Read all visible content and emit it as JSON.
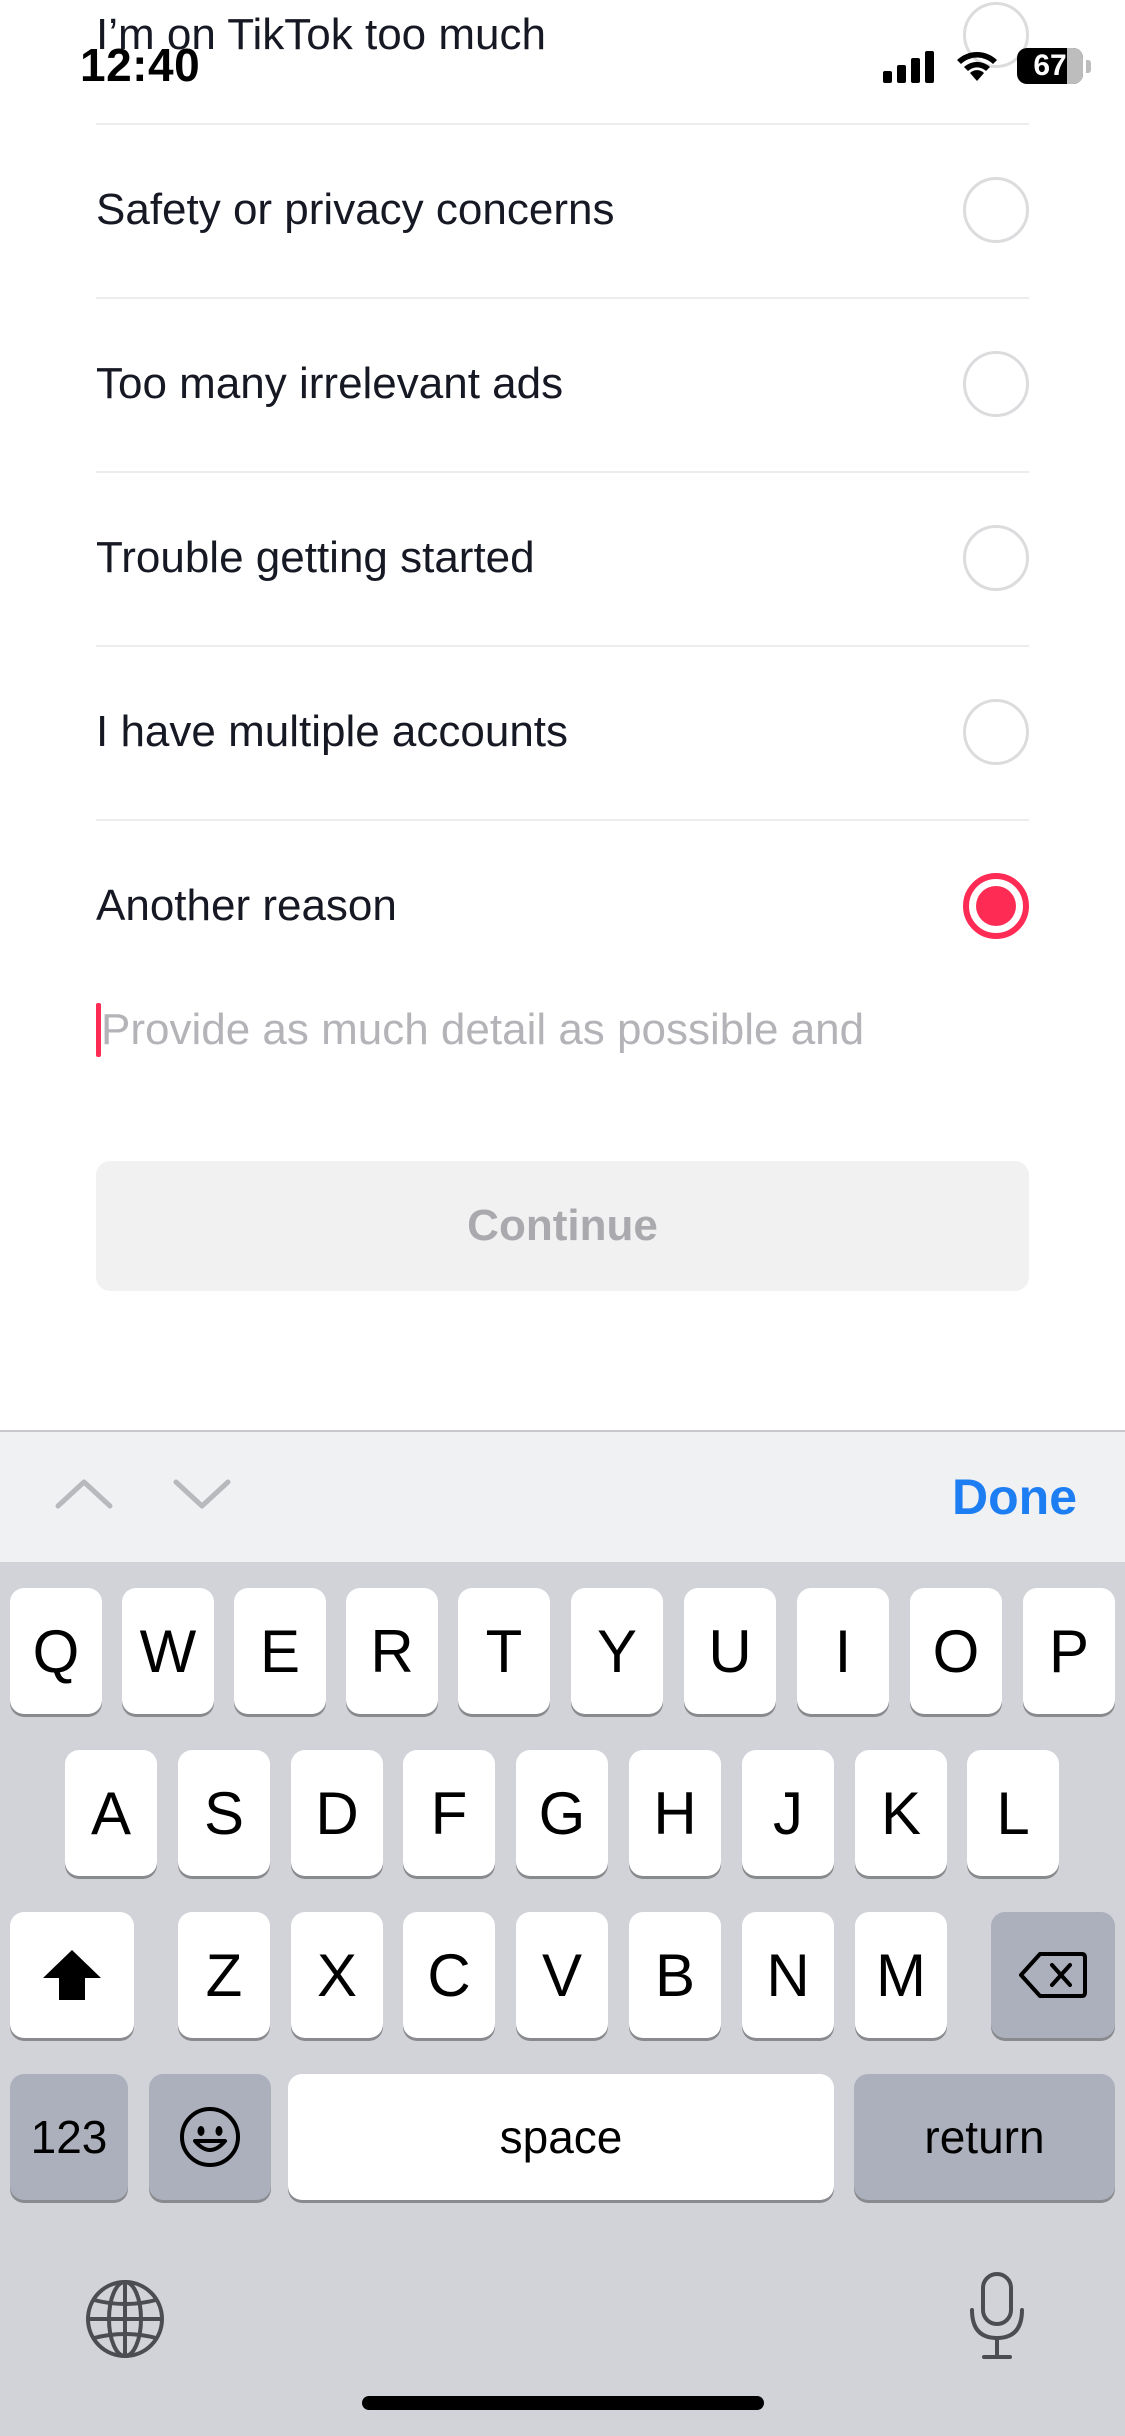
{
  "status_bar": {
    "time": "12:40",
    "battery": "67"
  },
  "options": [
    {
      "label": "I’m on TikTok too much",
      "selected": false
    },
    {
      "label": "Safety or privacy concerns",
      "selected": false
    },
    {
      "label": "Too many irrelevant ads",
      "selected": false
    },
    {
      "label": "Trouble getting started",
      "selected": false
    },
    {
      "label": "I have multiple accounts",
      "selected": false
    },
    {
      "label": "Another reason",
      "selected": true
    }
  ],
  "detail_input": {
    "placeholder": "Provide as much detail as possible and",
    "value": ""
  },
  "continue_button": {
    "label": "Continue",
    "enabled": false
  },
  "accessory_bar": {
    "done_label": "Done"
  },
  "keyboard": {
    "row1": [
      "Q",
      "W",
      "E",
      "R",
      "T",
      "Y",
      "U",
      "I",
      "O",
      "P"
    ],
    "row2": [
      "A",
      "S",
      "D",
      "F",
      "G",
      "H",
      "J",
      "K",
      "L"
    ],
    "row3": [
      "Z",
      "X",
      "C",
      "V",
      "B",
      "N",
      "M"
    ],
    "numbers_label": "123",
    "space_label": "space",
    "return_label": "return"
  },
  "colors": {
    "accent": "#fe2c55",
    "done_blue": "#1c7ef2",
    "keyboard_bg": "#d1d3d9"
  }
}
